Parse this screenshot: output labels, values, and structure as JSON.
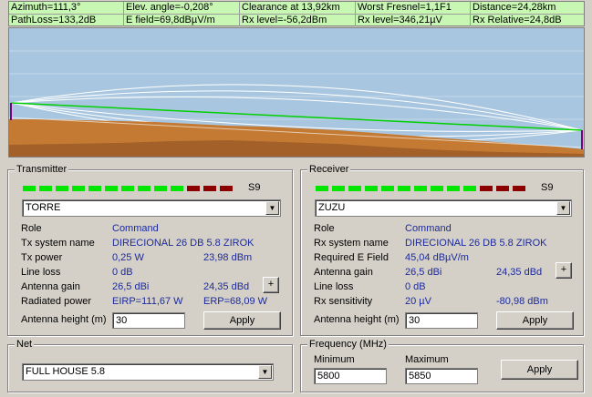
{
  "status": {
    "row1": [
      "Azimuth=111,3°",
      "Elev. angle=-0,208°",
      "Clearance at 13,92km",
      "Worst Fresnel=1,1F1",
      "Distance=24,28km"
    ],
    "row2": [
      "PathLoss=133,2dB",
      "E field=69,8dBµV/m",
      "Rx level=-56,2dBm",
      "Rx level=346,21µV",
      "Rx Relative=24,8dB"
    ]
  },
  "colors": {
    "sky": "#a9c6e0",
    "terrain": "#c47a32",
    "terrain_dark": "#7a4a20",
    "los_line": "#00d000",
    "fresnel": "#ffffff",
    "value_text": "#1c2a9c"
  },
  "transmitter": {
    "title": "Transmitter",
    "s9": "S9",
    "station": "TORRE",
    "rows": [
      {
        "label": "Role",
        "value": "Command",
        "value2": ""
      },
      {
        "label": "Tx system name",
        "value": "DIRECIONAL  26 DB 5.8 ZIROK",
        "value2": ""
      },
      {
        "label": "Tx power",
        "value": "0,25 W",
        "value2": "23,98 dBm"
      },
      {
        "label": "Line loss",
        "value": "0 dB",
        "value2": ""
      },
      {
        "label": "Antenna gain",
        "value": "26,5 dBi",
        "value2": "24,35 dBd"
      },
      {
        "label": "Radiated power",
        "value": "EIRP=111,67 W",
        "value2": "ERP=68,09 W"
      }
    ],
    "antenna_height_label": "Antenna height (m)",
    "antenna_height": "30",
    "apply": "Apply",
    "plus": "+"
  },
  "receiver": {
    "title": "Receiver",
    "s9": "S9",
    "station": "ZUZU",
    "rows": [
      {
        "label": "Role",
        "value": "Command",
        "value2": ""
      },
      {
        "label": "Rx system name",
        "value": "DIRECIONAL  26 DB 5.8 ZIROK",
        "value2": ""
      },
      {
        "label": "Required E Field",
        "value": "45,04 dBµV/m",
        "value2": ""
      },
      {
        "label": "Antenna gain",
        "value": "26,5 dBi",
        "value2": "24,35 dBd"
      },
      {
        "label": "Line loss",
        "value": "0 dB",
        "value2": ""
      },
      {
        "label": "Rx sensitivity",
        "value": "20 µV",
        "value2": "-80,98 dBm"
      }
    ],
    "antenna_height_label": "Antenna height (m)",
    "antenna_height": "30",
    "apply": "Apply",
    "plus": "+"
  },
  "net": {
    "title": "Net",
    "selected": "FULL HOUSE 5.8"
  },
  "frequency": {
    "title": "Frequency (MHz)",
    "min_label": "Minimum",
    "max_label": "Maximum",
    "min": "5800",
    "max": "5850",
    "apply": "Apply"
  }
}
